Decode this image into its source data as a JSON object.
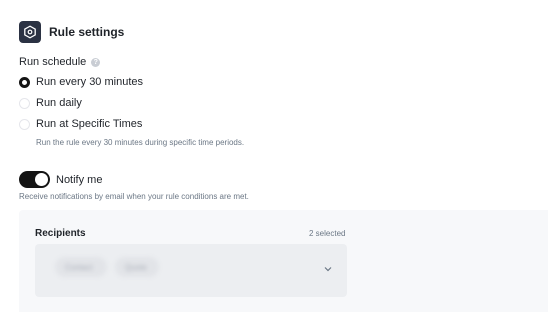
{
  "header": {
    "title": "Rule settings",
    "icon": "hexagon-settings-icon",
    "icon_bg": "#2b3243"
  },
  "schedule": {
    "label": "Run schedule",
    "help_icon": "?",
    "options": [
      {
        "label": "Run every 30 minutes",
        "checked": true
      },
      {
        "label": "Run daily",
        "checked": false
      },
      {
        "label": "Run at Specific Times",
        "checked": false
      }
    ],
    "hint": "Run the rule every 30 minutes during specific time periods."
  },
  "notify": {
    "label": "Notify me",
    "enabled": true,
    "hint": "Receive notifications by email when your rule conditions are met."
  },
  "recipients": {
    "title": "Recipients",
    "selected": "2 selected",
    "chips": [
      "Contact",
      "Quote"
    ]
  },
  "colors": {
    "accent": "#141414",
    "panel_bg": "#f7f8fa",
    "muted_text": "#6b7785"
  }
}
